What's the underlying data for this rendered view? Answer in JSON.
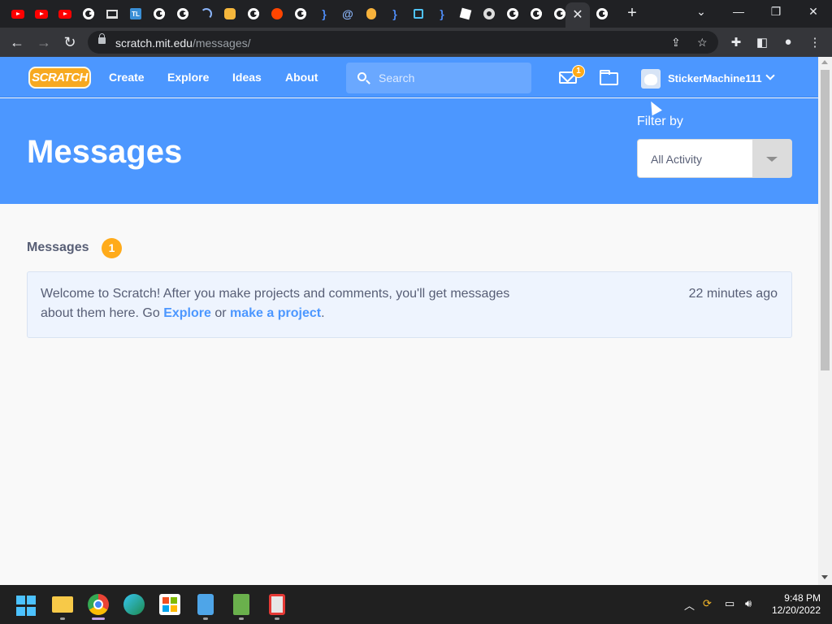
{
  "browser": {
    "tabs": [
      {
        "icon": "youtube-icon"
      },
      {
        "icon": "youtube-icon"
      },
      {
        "icon": "youtube-icon"
      },
      {
        "icon": "google-icon"
      },
      {
        "icon": "monitor-icon"
      },
      {
        "icon": "tl-icon",
        "text": "TL"
      },
      {
        "icon": "google-icon"
      },
      {
        "icon": "google-icon"
      },
      {
        "icon": "wave-icon"
      },
      {
        "icon": "cookie-icon"
      },
      {
        "icon": "google-icon"
      },
      {
        "icon": "reddit-icon"
      },
      {
        "icon": "google-icon"
      },
      {
        "icon": "brace-icon"
      },
      {
        "icon": "at-icon"
      },
      {
        "icon": "bitcoin-icon"
      },
      {
        "icon": "brace-icon"
      },
      {
        "icon": "square-icon"
      },
      {
        "icon": "brace-icon"
      },
      {
        "icon": "roblox-icon"
      },
      {
        "icon": "chromium-icon"
      },
      {
        "icon": "google-icon"
      },
      {
        "icon": "google-icon"
      },
      {
        "icon": "google-icon"
      },
      {
        "icon": "close-icon",
        "active": true
      },
      {
        "icon": "google-icon"
      }
    ],
    "new_tab": "+",
    "url_host": "scratch.mit.edu",
    "url_path": "/messages/"
  },
  "nav": {
    "logo": "SCRATCH",
    "create": "Create",
    "explore": "Explore",
    "ideas": "Ideas",
    "about": "About",
    "search_placeholder": "Search",
    "messages_count": "1",
    "username": "StickerMachine111"
  },
  "banner": {
    "title": "Messages",
    "filter_label": "Filter by",
    "filter_value": "All Activity"
  },
  "messages": {
    "section_title": "Messages",
    "count": "1",
    "items": [
      {
        "text_before": "Welcome to Scratch! After you make projects and comments, you'll get messages about them here. Go ",
        "link1": "Explore",
        "text_middle": " or ",
        "link2": "make a project",
        "text_after": ".",
        "time": "22 minutes ago"
      }
    ]
  },
  "taskbar": {
    "time": "9:48 PM",
    "date": "12/20/2022"
  },
  "colors": {
    "scratch_blue": "#4c97ff",
    "badge_orange": "#ffab1a",
    "message_bg": "#eef4fe"
  }
}
